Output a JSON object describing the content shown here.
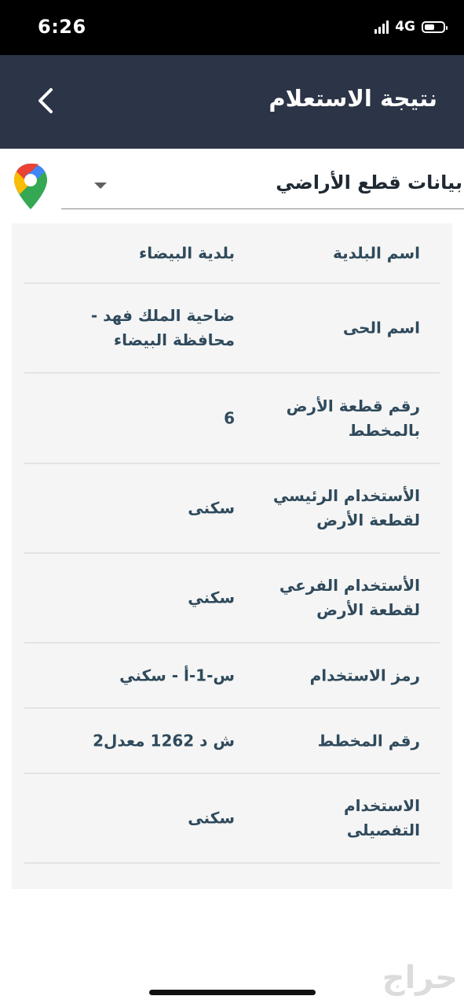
{
  "status_bar": {
    "time": "6:26",
    "network": "4G"
  },
  "header": {
    "title": "نتيجة الاستعلام",
    "back_icon": "chevron-left-icon"
  },
  "section_selector": {
    "selected": "بيانات قطع الأراضي",
    "maps_icon": "google-maps-pin-icon"
  },
  "land_details": [
    {
      "label": "اسم البلدية",
      "value": "بلدية البيضاء"
    },
    {
      "label": "اسم الحى",
      "value": "ضاحية الملك فهد - محافظة البيضاء"
    },
    {
      "label": "رقم قطعة الأرض بالمخطط",
      "value": "6"
    },
    {
      "label": "الأستخدام الرئيسي لقطعة الأرض",
      "value": "سكنى"
    },
    {
      "label": "الأستخدام الفرعي لقطعة الأرض",
      "value": "سكني"
    },
    {
      "label": "رمز الاستخدام",
      "value": "س-1-أ - سكني"
    },
    {
      "label": "رقم المخطط",
      "value": "ش د 1262 معدل2"
    },
    {
      "label": "الاستخدام التفصيلى",
      "value": "سكنى"
    }
  ],
  "watermark": "حراج",
  "colors": {
    "header_bg": "#2c3447",
    "text": "#2f4a5c",
    "card_bg": "#f5f5f5"
  }
}
